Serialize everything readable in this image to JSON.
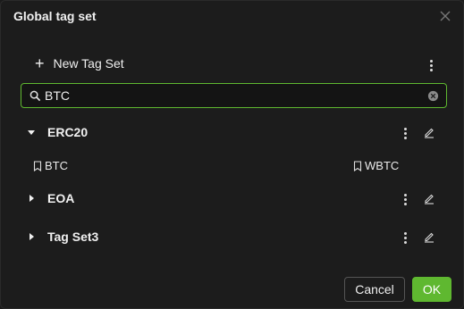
{
  "dialog": {
    "title": "Global tag set",
    "new_tag_set_label": "New Tag Set",
    "search": {
      "value": "BTC",
      "placeholder": ""
    },
    "groups": [
      {
        "name": "ERC20",
        "expanded": true,
        "tags": [
          "BTC",
          "WBTC"
        ]
      },
      {
        "name": "EOA",
        "expanded": false
      },
      {
        "name": "Tag Set3",
        "expanded": false
      }
    ],
    "buttons": {
      "cancel": "Cancel",
      "ok": "OK"
    }
  },
  "colors": {
    "accent": "#5fb830",
    "background": "#1c1c1c"
  },
  "icons": [
    "close-icon",
    "plus-icon",
    "more-vertical-icon",
    "search-icon",
    "clear-icon",
    "caret-down-icon",
    "caret-right-icon",
    "edit-pencil-icon",
    "bookmark-icon"
  ]
}
